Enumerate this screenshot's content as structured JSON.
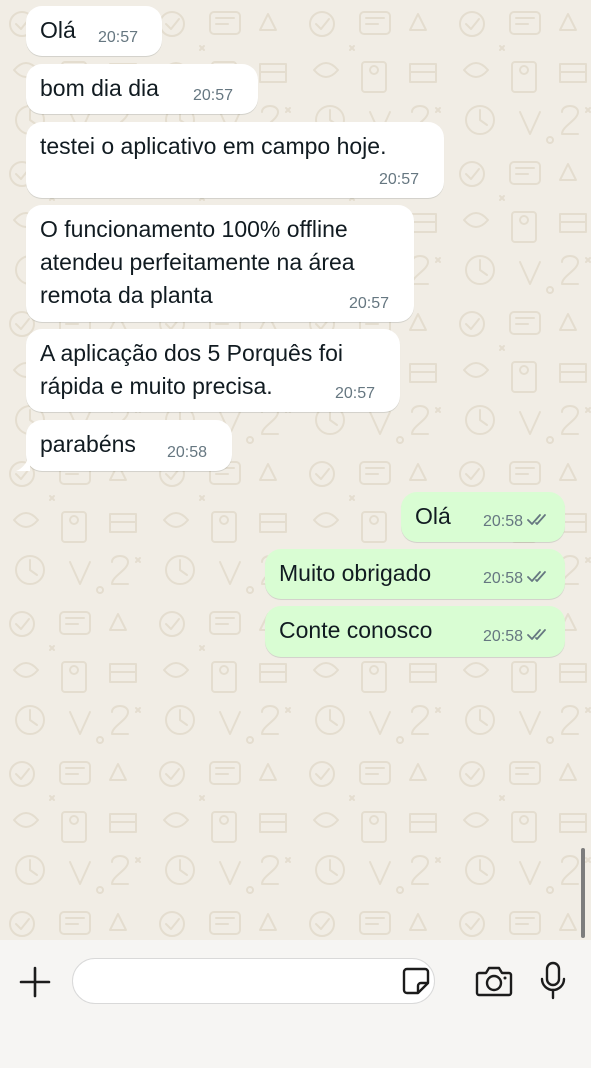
{
  "conversation": {
    "messages": [
      {
        "direction": "incoming",
        "lines": [
          "Olá"
        ],
        "time": "20:57"
      },
      {
        "direction": "incoming",
        "lines": [
          "bom dia dia"
        ],
        "time": "20:57"
      },
      {
        "direction": "incoming",
        "lines": [
          "testei o aplicativo em campo hoje."
        ],
        "time": "20:57"
      },
      {
        "direction": "incoming",
        "lines": [
          "O funcionamento 100% offline",
          "atendeu perfeitamente na área",
          "remota da planta"
        ],
        "time": "20:57"
      },
      {
        "direction": "incoming",
        "lines": [
          "A aplicação dos 5 Porquês foi",
          "rápida e muito precisa."
        ],
        "time": "20:57"
      },
      {
        "direction": "incoming",
        "lines": [
          "parabéns"
        ],
        "time": "20:58"
      },
      {
        "direction": "outgoing",
        "lines": [
          "Olá"
        ],
        "time": "20:58",
        "status": "read-double-check"
      },
      {
        "direction": "outgoing",
        "lines": [
          "Muito obrigado"
        ],
        "time": "20:58",
        "status": "read-double-check"
      },
      {
        "direction": "outgoing",
        "lines": [
          "Conte conosco"
        ],
        "time": "20:58",
        "status": "read-double-check"
      }
    ]
  },
  "composer": {
    "placeholder": "",
    "value": "",
    "icons": {
      "attach": "plus-icon",
      "sticker": "sticker-icon",
      "camera": "camera-icon",
      "mic": "microphone-icon"
    }
  },
  "colors": {
    "background": "#f1ede5",
    "incoming_bubble": "#ffffff",
    "outgoing_bubble": "#d9fdd3",
    "timestamp": "#667781",
    "wallpaper_doodle": "#e6e0d3"
  }
}
